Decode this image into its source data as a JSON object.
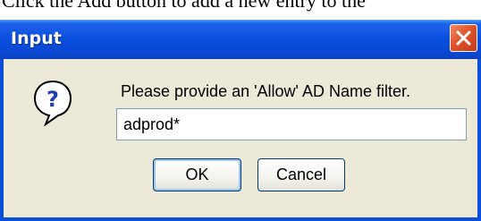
{
  "background_text": "Click the Add button to add a new entry to the",
  "dialog": {
    "title": "Input",
    "close_icon": "close-icon",
    "message_icon": "question-icon",
    "prompt": "Please provide an 'Allow' AD Name filter.",
    "input_value": "adprod*",
    "buttons": {
      "ok_label": "OK",
      "cancel_label": "Cancel"
    }
  },
  "colors": {
    "frame": "#0a4fd8",
    "titlebar": "#0b4fe0",
    "close_button": "#e0542c",
    "dialog_bg": "#ece9d8",
    "question_icon": "#1f3fb0"
  }
}
